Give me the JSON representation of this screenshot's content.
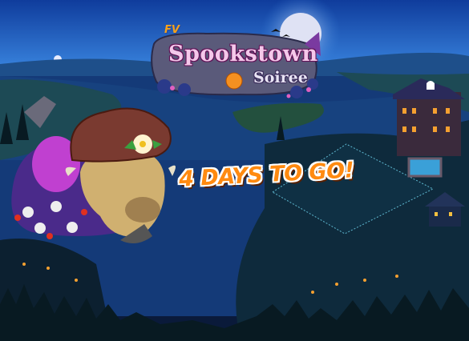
{
  "event": {
    "badge": "FV",
    "title": "Spookstown",
    "subtitle": "Soiree",
    "countdown": "4 DAYS TO GO!"
  },
  "colors": {
    "sky_top": "#1a4fb0",
    "sky_bottom": "#2c7ad8",
    "lake": "#163a7a",
    "countdown_text": "#ff8a10",
    "title_text": "#f4c8ea"
  }
}
